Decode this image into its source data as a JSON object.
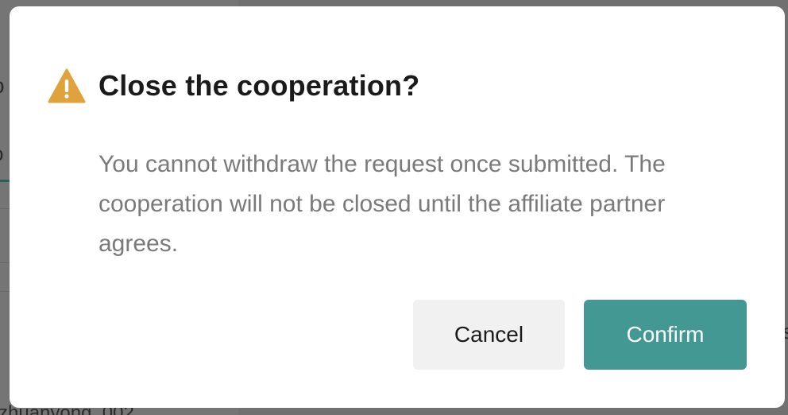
{
  "background": {
    "fragment_heading": "o",
    "fragment_tab": "o",
    "fragment_footer": "zhuanyong_002",
    "fragment_right": "s"
  },
  "dialog": {
    "icon": "warning-icon",
    "icon_color": "#E0A23C",
    "title": "Close the cooperation?",
    "message": "You cannot withdraw the request once submitted. The cooperation will not be closed until the affiliate partner agrees.",
    "cancel_label": "Cancel",
    "confirm_label": "Confirm",
    "confirm_color": "#439893"
  }
}
